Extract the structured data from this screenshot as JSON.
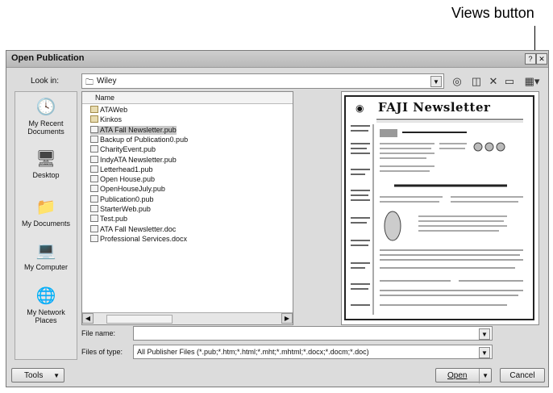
{
  "callout": {
    "label": "Views button"
  },
  "dialog": {
    "title": "Open Publication",
    "look_in_label": "Look in:",
    "look_in_value": "Wiley",
    "toolbar_icons": [
      "back-icon",
      "up-folder-icon",
      "delete-icon",
      "new-folder-icon",
      "views-icon"
    ],
    "places": [
      {
        "label": "My Recent Documents",
        "icon": "recent-documents-icon"
      },
      {
        "label": "Desktop",
        "icon": "desktop-icon"
      },
      {
        "label": "My Documents",
        "icon": "my-documents-icon"
      },
      {
        "label": "My Computer",
        "icon": "my-computer-icon"
      },
      {
        "label": "My Network Places",
        "icon": "network-places-icon"
      }
    ],
    "file_list": {
      "column_name": "Name",
      "items": [
        {
          "name": "ATAWeb",
          "type": "folder"
        },
        {
          "name": "Kinkos",
          "type": "folder"
        },
        {
          "name": "ATA Fall Newsletter.pub",
          "type": "pub",
          "selected": true
        },
        {
          "name": "Backup of Publication0.pub",
          "type": "pub"
        },
        {
          "name": "CharityEvent.pub",
          "type": "pub"
        },
        {
          "name": "IndyATA Newsletter.pub",
          "type": "pub"
        },
        {
          "name": "Letterhead1.pub",
          "type": "pub"
        },
        {
          "name": "Open House.pub",
          "type": "pub"
        },
        {
          "name": "OpenHouseJuly.pub",
          "type": "pub"
        },
        {
          "name": "Publication0.pub",
          "type": "pub"
        },
        {
          "name": "StarterWeb.pub",
          "type": "pub"
        },
        {
          "name": "Test.pub",
          "type": "pub"
        },
        {
          "name": "ATA Fall Newsletter.doc",
          "type": "doc"
        },
        {
          "name": "Professional Services.docx",
          "type": "doc"
        }
      ]
    },
    "preview": {
      "title": "FAJI Newsletter"
    },
    "file_name_label": "File name:",
    "file_name_value": "",
    "file_type_label": "Files of type:",
    "file_type_value": "All Publisher Files (*.pub;*.htm;*.html;*.mht;*.mhtml;*.docx;*.docm;*.doc)",
    "tools_label": "Tools",
    "open_label": "Open",
    "cancel_label": "Cancel"
  }
}
